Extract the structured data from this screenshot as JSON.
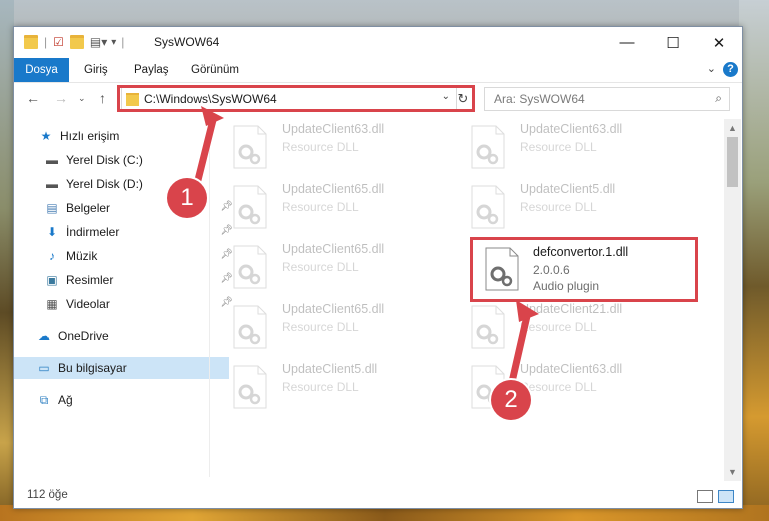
{
  "window": {
    "title": "SysWOW64",
    "controls": {
      "minimize": "—",
      "maximize": "☐",
      "close": "✕"
    }
  },
  "ribbon": {
    "tabs": [
      "Dosya",
      "Giriş",
      "Paylaş",
      "Görünüm"
    ],
    "active_tab_color": "#1979ca",
    "help": "?"
  },
  "nav": {
    "address": "C:\\Windows\\SysWOW64",
    "search_placeholder": "Ara: SysWOW64"
  },
  "sidebar": {
    "items": [
      {
        "label": "Hızlı erişim",
        "icon": "star-icon"
      },
      {
        "label": "Yerel Disk (C:)",
        "icon": "drive-icon"
      },
      {
        "label": "Yerel Disk (D:)",
        "icon": "drive-icon"
      },
      {
        "label": "Belgeler",
        "icon": "documents-icon",
        "pinned": true
      },
      {
        "label": "İndirmeler",
        "icon": "download-icon",
        "pinned": true
      },
      {
        "label": "Müzik",
        "icon": "music-icon",
        "pinned": true
      },
      {
        "label": "Resimler",
        "icon": "pictures-icon",
        "pinned": true
      },
      {
        "label": "Videolar",
        "icon": "videos-icon",
        "pinned": true
      },
      {
        "label": "OneDrive",
        "icon": "onedrive-icon"
      },
      {
        "label": "Bu bilgisayar",
        "icon": "computer-icon",
        "selected": true
      },
      {
        "label": "Ağ",
        "icon": "network-icon"
      }
    ]
  },
  "files": [
    {
      "name": "UpdateClient63.dll",
      "type": "Resource DLL"
    },
    {
      "name": "UpdateClient63.dll",
      "type": "Resource DLL"
    },
    {
      "name": "UpdateClient65.dll",
      "type": "Resource DLL"
    },
    {
      "name": "UpdateClient5.dll",
      "type": "Resource DLL"
    },
    {
      "name": "UpdateClient65.dll",
      "type": "Resource DLL"
    },
    {
      "name": "defconvertor.1.dll",
      "version": "2.0.0.6",
      "type": "Audio plugin",
      "highlighted": true
    },
    {
      "name": "UpdateClient65.dll",
      "type": "Resource DLL"
    },
    {
      "name": "UpdateClient21.dll",
      "type": "Resource DLL"
    },
    {
      "name": "UpdateClient5.dll",
      "type": "Resource DLL"
    },
    {
      "name": "UpdateClient63.dll",
      "type": "Resource DLL"
    }
  ],
  "status": {
    "item_count": "112 öğe"
  },
  "annotations": {
    "badge1": "1",
    "badge2": "2",
    "color": "#d9444b"
  }
}
